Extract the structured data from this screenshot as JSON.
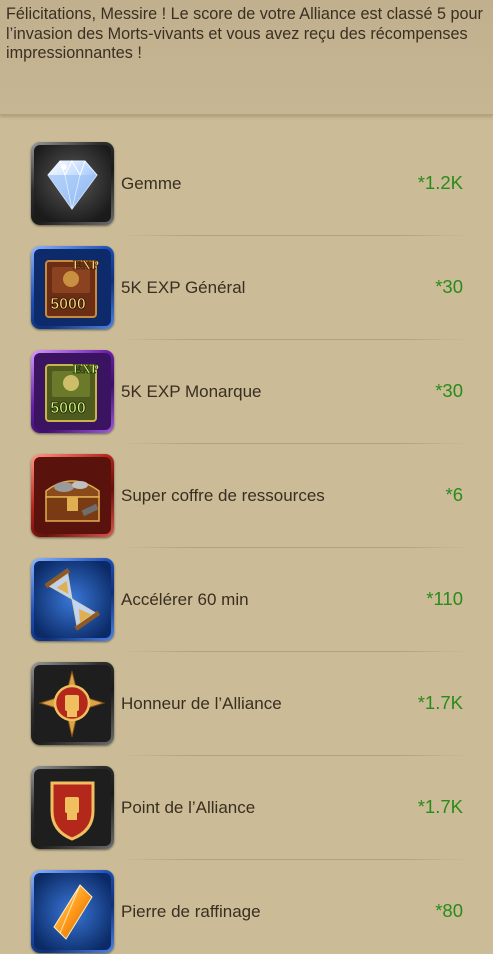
{
  "header": {
    "message": "Félicitations, Messire ! Le score de votre Alliance est classé 5 pour l’invasion des Morts-vivants et vous avez reçu des récompenses impressionnantes !"
  },
  "rewards": [
    {
      "label": "Gemme",
      "qty": "*1.2K",
      "icon": "gem-icon",
      "frame": "#7a7a7a"
    },
    {
      "label": "5K EXP Général",
      "qty": "*30",
      "icon": "exp-book-general-icon",
      "frame": "#3b6fd1",
      "badge": "5000",
      "tag": "EXP"
    },
    {
      "label": "5K EXP Monarque",
      "qty": "*30",
      "icon": "exp-book-monarch-icon",
      "frame": "#8a3fc8",
      "badge": "5000",
      "tag": "EXP"
    },
    {
      "label": "Super coffre de ressources",
      "qty": "*6",
      "icon": "resource-chest-icon",
      "frame": "#c23a2f"
    },
    {
      "label": "Accélérer 60 min",
      "qty": "*110",
      "icon": "hourglass-icon",
      "frame": "#3b6fd1"
    },
    {
      "label": "Honneur de l’Alliance",
      "qty": "*1.7K",
      "icon": "alliance-honor-icon",
      "frame": "#7a7a7a"
    },
    {
      "label": "Point de l’Alliance",
      "qty": "*1.7K",
      "icon": "alliance-point-icon",
      "frame": "#7a7a7a"
    },
    {
      "label": "Pierre de raffinage",
      "qty": "*80",
      "icon": "refining-stone-icon",
      "frame": "#3b6fd1"
    }
  ]
}
